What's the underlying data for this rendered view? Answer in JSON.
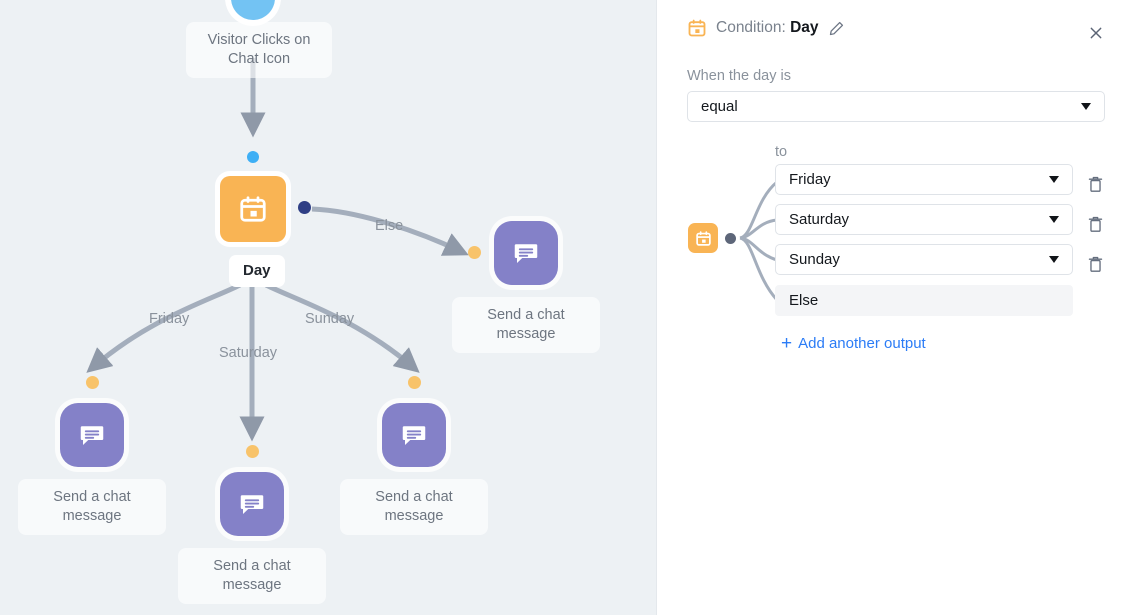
{
  "canvas": {
    "background_color": "#edf1f4",
    "trigger_node": {
      "caption": "Visitor Clicks on Chat Icon",
      "icon": "chat-bubble-circle-icon",
      "color": "#73c3f3"
    },
    "condition_node": {
      "label": "Day",
      "icon": "calendar-icon",
      "color": "#f9b454"
    },
    "edge_labels": [
      "Else",
      "Friday",
      "Saturday",
      "Sunday"
    ],
    "action_nodes": [
      {
        "caption": "Send a chat message",
        "icon": "chat-message-icon",
        "color": "#8481c8",
        "branch": "Else"
      },
      {
        "caption": "Send a chat message",
        "icon": "chat-message-icon",
        "color": "#8481c8",
        "branch": "Friday"
      },
      {
        "caption": "Send a chat message",
        "icon": "chat-message-icon",
        "color": "#8481c8",
        "branch": "Saturday"
      },
      {
        "caption": "Send a chat message",
        "icon": "chat-message-icon",
        "color": "#8481c8",
        "branch": "Sunday"
      }
    ],
    "connector_color": "#a4aebc",
    "port_colors": {
      "input": "#3eaff5",
      "output": "#2f3f85",
      "action_input": "#f8c36a"
    }
  },
  "panel": {
    "header": {
      "icon": "calendar-icon",
      "prefix": "Condition:",
      "name": "Day",
      "edit_icon": "pencil-icon",
      "close_icon": "close-icon"
    },
    "operator_label": "When the day is",
    "operator_value": "equal",
    "to_label": "to",
    "outputs": [
      {
        "value": "Friday",
        "deletable": true,
        "delete_icon": "trash-icon"
      },
      {
        "value": "Saturday",
        "deletable": true,
        "delete_icon": "trash-icon"
      },
      {
        "value": "Sunday",
        "deletable": true,
        "delete_icon": "trash-icon"
      }
    ],
    "else_output": "Else",
    "add_output_label": "Add another output",
    "add_output_glyph": "+",
    "mini_node_icon": "calendar-icon",
    "accent_color": "#2b7cf6",
    "node_color": "#f9b454"
  }
}
